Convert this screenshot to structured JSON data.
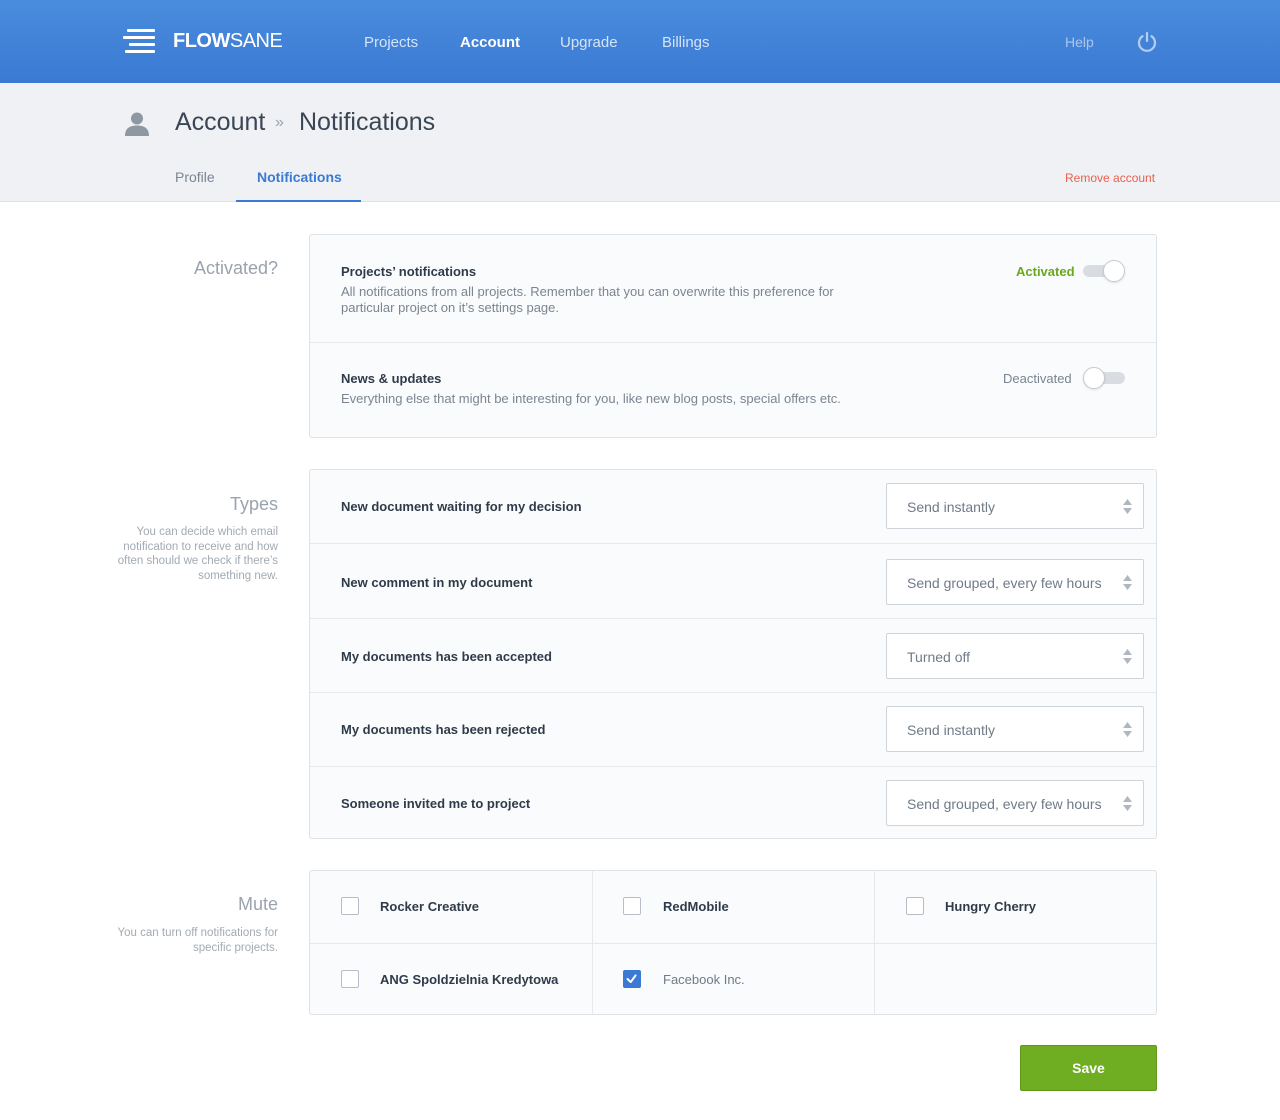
{
  "header": {
    "brand_bold": "FLOW",
    "brand_light": "SANE",
    "nav": [
      "Projects",
      "Account",
      "Upgrade",
      "Billings"
    ],
    "active_nav": "Account",
    "help": "Help"
  },
  "breadcrumb": {
    "parent": "Account",
    "separator": "»",
    "current": "Notifications"
  },
  "tabs": [
    "Profile",
    "Notifications"
  ],
  "remove_account": "Remove account",
  "activated": {
    "title": "Activated?",
    "items": [
      {
        "title": "Projects’ notifications",
        "description": "All notifications from all projects. Remember that you can overwrite this preference for particular project on it’s settings page.",
        "state_label": "Activated",
        "on": true
      },
      {
        "title": "News & updates",
        "description": "Everything else that might be interesting for you, like new blog posts, special offers etc.",
        "state_label": "Deactivated",
        "on": false
      }
    ]
  },
  "types": {
    "title": "Types",
    "description": "You can decide which email notification to receive and how often should we check if there’s something new.",
    "items": [
      {
        "label": "New document waiting for my decision",
        "value": "Send instantly"
      },
      {
        "label": "New comment in my document",
        "value": "Send grouped, every few hours"
      },
      {
        "label": "My documents has been accepted",
        "value": "Turned off"
      },
      {
        "label": "My documents has been rejected",
        "value": "Send instantly"
      },
      {
        "label": "Someone invited me to project",
        "value": "Send grouped, every few hours"
      }
    ]
  },
  "mute": {
    "title": "Mute",
    "description": "You can turn off notifications for specific projects.",
    "projects": [
      {
        "name": "Rocker Creative",
        "checked": false
      },
      {
        "name": "RedMobile",
        "checked": false
      },
      {
        "name": "Hungry Cherry",
        "checked": false
      },
      {
        "name": "ANG Spoldzielnia Kredytowa",
        "checked": false
      },
      {
        "name": "Facebook Inc.",
        "checked": true
      }
    ]
  },
  "save_label": "Save",
  "colors": {
    "accent": "#3a7ad4",
    "success": "#6fae22",
    "danger": "#e8614e",
    "activated_text": "#69a81d"
  }
}
